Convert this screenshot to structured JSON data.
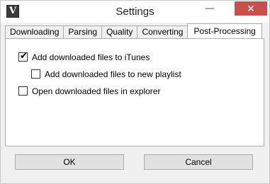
{
  "window": {
    "title": "Settings",
    "app_icon_glyph": "V",
    "minimize_glyph": "—",
    "close_glyph": "✕"
  },
  "tabs": [
    {
      "label": "Downloading",
      "active": false
    },
    {
      "label": "Parsing",
      "active": false
    },
    {
      "label": "Quality",
      "active": false
    },
    {
      "label": "Converting",
      "active": false
    },
    {
      "label": "Post-Processing",
      "active": true
    }
  ],
  "options": {
    "itunes": {
      "label": "Add downloaded files to iTunes",
      "checked": true,
      "check_glyph": "✔"
    },
    "playlist": {
      "label": "Add downloaded files to new playlist",
      "checked": false
    },
    "explorer": {
      "label": "Open downloaded files in explorer",
      "checked": false
    }
  },
  "buttons": {
    "ok": "OK",
    "cancel": "Cancel"
  },
  "colors": {
    "close_button": "#c7504b",
    "client_background": "#f0f0f0",
    "panel_background": "#ffffff"
  }
}
